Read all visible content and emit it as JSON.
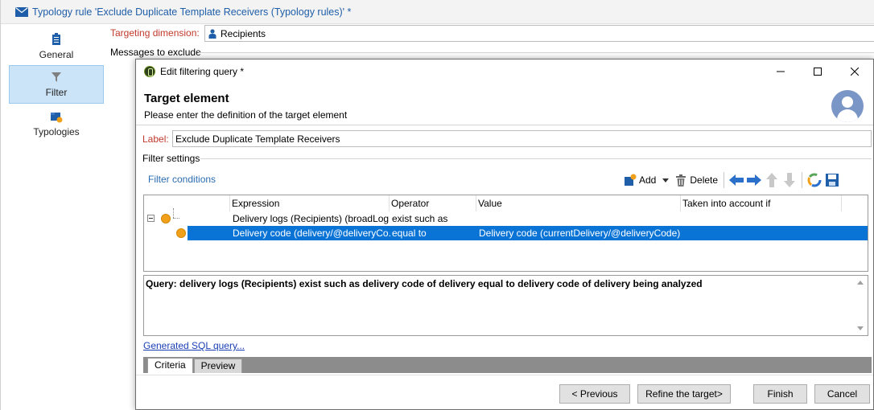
{
  "window": {
    "title": "Typology rule 'Exclude Duplicate Template Receivers (Typology rules)' *"
  },
  "sidebar": {
    "items": [
      {
        "label": "General",
        "icon": "document-icon",
        "active": false
      },
      {
        "label": "Filter",
        "icon": "funnel-icon",
        "active": true
      },
      {
        "label": "Typologies",
        "icon": "typology-icon",
        "active": false
      }
    ]
  },
  "background_form": {
    "targeting_label": "Targeting dimension:",
    "targeting_value": "Recipients",
    "messages_label": "Messages to exclude"
  },
  "dialog": {
    "title": "Edit filtering query *",
    "header_title": "Target element",
    "header_subtitle": "Please enter the definition of the target element",
    "label_caption": "Label:",
    "label_value": "Exclude Duplicate Template Receivers",
    "filter_settings": "Filter settings",
    "filter_conditions": "Filter conditions",
    "toolbar": {
      "add": "Add",
      "delete": "Delete"
    },
    "grid": {
      "columns": [
        "Expression",
        "Operator",
        "Value",
        "Taken into account if"
      ],
      "rows": [
        {
          "expression": "Delivery logs (Recipients) (broadLog)",
          "operator": "exist such as",
          "value": "",
          "taken": ""
        },
        {
          "expression": "Delivery code (delivery/@deliveryCo...",
          "operator": "equal to",
          "value": "Delivery code (currentDelivery/@deliveryCode)",
          "taken": ""
        }
      ]
    },
    "query": "Query: delivery logs (Recipients) exist such as delivery code of delivery equal to delivery code of delivery being analyzed",
    "sql_link": "Generated SQL query...",
    "tabs": [
      "Criteria",
      "Preview"
    ],
    "buttons": {
      "previous": "< Previous",
      "refine": "Refine the target>",
      "finish": "Finish",
      "cancel": "Cancel"
    }
  },
  "colors": {
    "accent": "#0a74d6",
    "required_label": "#c0392b",
    "link": "#2b6cb0",
    "condition_dot": "#f0a01a"
  }
}
